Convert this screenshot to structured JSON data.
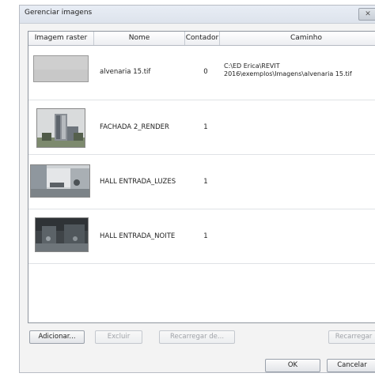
{
  "window": {
    "title": "Gerenciar imagens",
    "close_glyph": "✕"
  },
  "table": {
    "columns": [
      "Imagem raster",
      "Nome",
      "Contador",
      "Caminho"
    ],
    "rows": [
      {
        "thumbnail": "blank-gray-thumbnail",
        "name": "alvenaria 15.tif",
        "count": "0",
        "path": "C:\\ED Erica\\REVIT\n2016\\exemplos\\Imagens\\alvenaria 15.tif"
      },
      {
        "thumbnail": "building-render-thumbnail",
        "name": "FACHADA 2_RENDER",
        "count": "1",
        "path": ""
      },
      {
        "thumbnail": "lit-hall-thumbnail",
        "name": "HALL ENTRADA_LUZES",
        "count": "1",
        "path": ""
      },
      {
        "thumbnail": "night-hall-thumbnail",
        "name": "HALL ENTRADA_NOITE",
        "count": "1",
        "path": ""
      }
    ]
  },
  "buttons": {
    "add": "Adicionar...",
    "delete": "Excluir",
    "reload_from": "Recarregar de...",
    "reload": "Recarregar",
    "ok": "OK",
    "cancel": "Cancelar"
  }
}
